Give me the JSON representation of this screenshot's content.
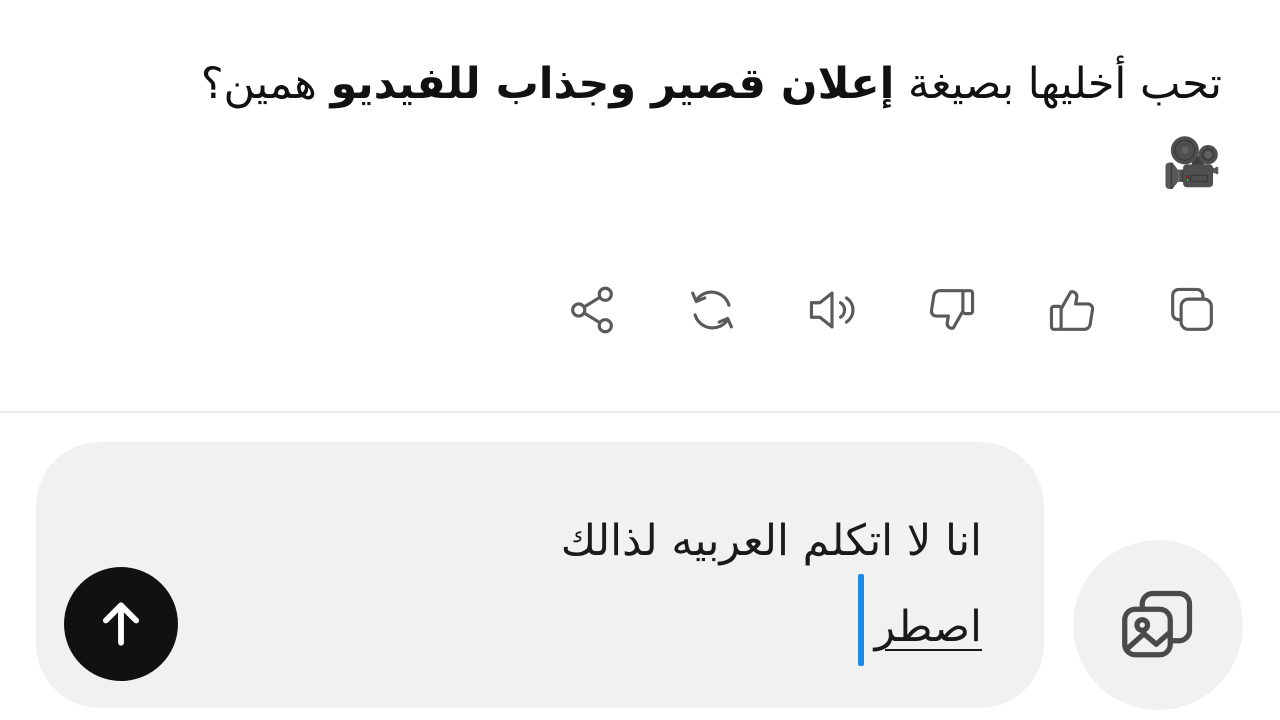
{
  "assistant": {
    "text_part1": "تحب أخليها بصيغة ",
    "text_bold": "إعلان قصير وجذاب للفيديو",
    "text_part2": " همين؟",
    "emoji": "🎥"
  },
  "actions": {
    "copy": "copy-icon",
    "like": "thumbs-up-icon",
    "dislike": "thumbs-down-icon",
    "read_aloud": "speaker-icon",
    "regenerate": "refresh-icon",
    "share": "share-icon"
  },
  "composer": {
    "line1": "انا لا اتكلم العربيه لذالك",
    "line2": "اصطر",
    "send_icon": "arrow-up-icon",
    "gallery_icon": "image-gallery-icon"
  },
  "colors": {
    "caret": "#1e88e5",
    "send_button": "#111111",
    "composer_bg": "#f1f1f1",
    "icon_gray": "#5a5a5a"
  }
}
